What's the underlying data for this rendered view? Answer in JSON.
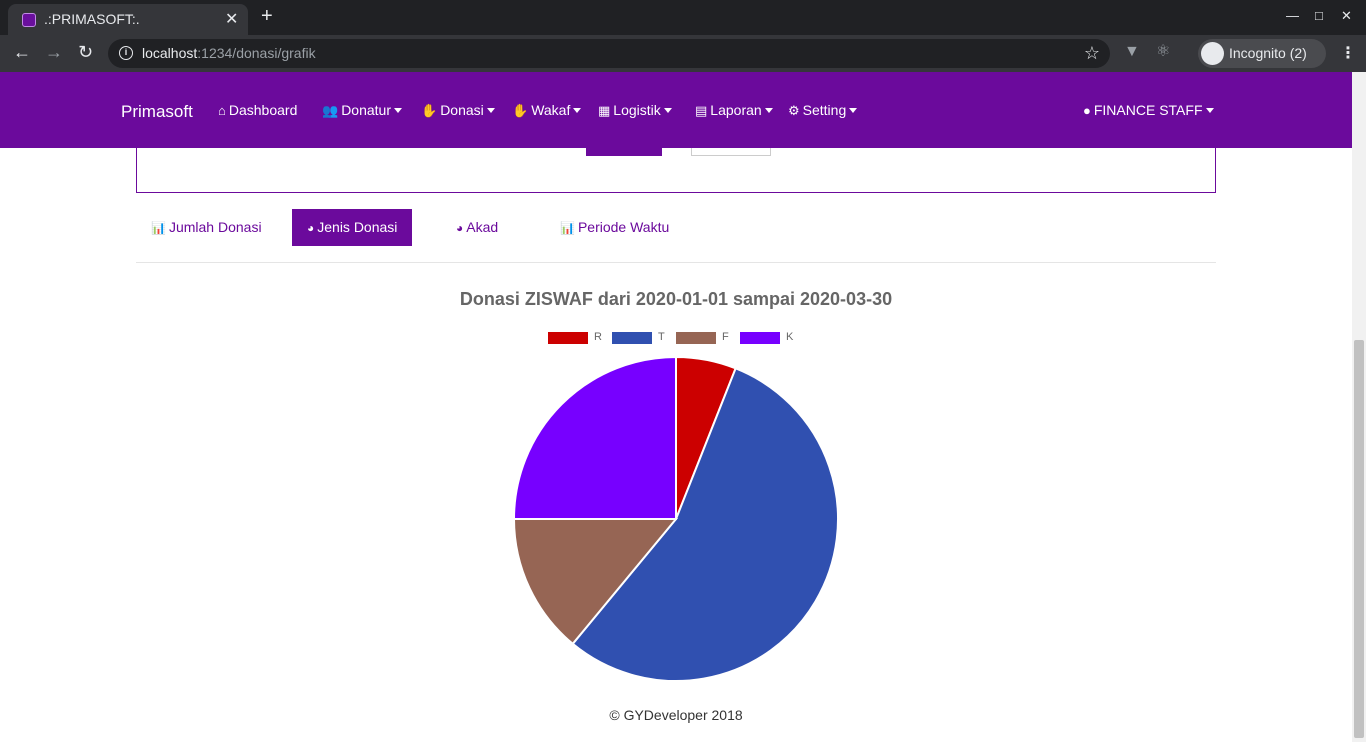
{
  "browser": {
    "tab_title": ".:PRIMASOFT:.",
    "tab_close": "✕",
    "new_tab": "+",
    "url_host": "localhost",
    "url_path": ":1234/donasi/grafik",
    "profile_label": "Incognito (2)"
  },
  "navbar": {
    "brand": "Primasoft",
    "items": [
      {
        "label": "Dashboard",
        "icon": "home-icon"
      },
      {
        "label": "Donatur",
        "icon": "users-icon"
      },
      {
        "label": "Donasi",
        "icon": "hand-holding-icon"
      },
      {
        "label": "Wakaf",
        "icon": "hand-holding-icon"
      },
      {
        "label": "Logistik",
        "icon": "warehouse-icon"
      },
      {
        "label": "Laporan",
        "icon": "file-icon"
      },
      {
        "label": "Setting",
        "icon": "cogs-icon"
      }
    ],
    "user": {
      "label": "FINANCE STAFF",
      "icon": "user-circle-icon"
    }
  },
  "tabs": [
    {
      "label": "Jumlah Donasi",
      "icon": "chart-bar-file-icon",
      "active": false
    },
    {
      "label": "Jenis Donasi",
      "icon": "chart-pie-boxes-icon",
      "active": true
    },
    {
      "label": "Akad",
      "icon": "chart-pie-handshake-icon",
      "active": false
    },
    {
      "label": "Periode Waktu",
      "icon": "chart-bar-clock-icon",
      "active": false
    }
  ],
  "chart_data": {
    "type": "pie",
    "title": "Donasi ZISWAF dari 2020-01-01 sampai 2020-03-30",
    "categories": [
      "R",
      "T",
      "F",
      "K"
    ],
    "values": [
      6,
      55,
      14,
      25
    ],
    "colors": [
      "#cc0000",
      "#3050b0",
      "#966554",
      "#7700ff"
    ],
    "legend": "top"
  },
  "footer": {
    "text": "© GYDeveloper 2018"
  },
  "colors": {
    "primary": "#6b0a9c"
  }
}
